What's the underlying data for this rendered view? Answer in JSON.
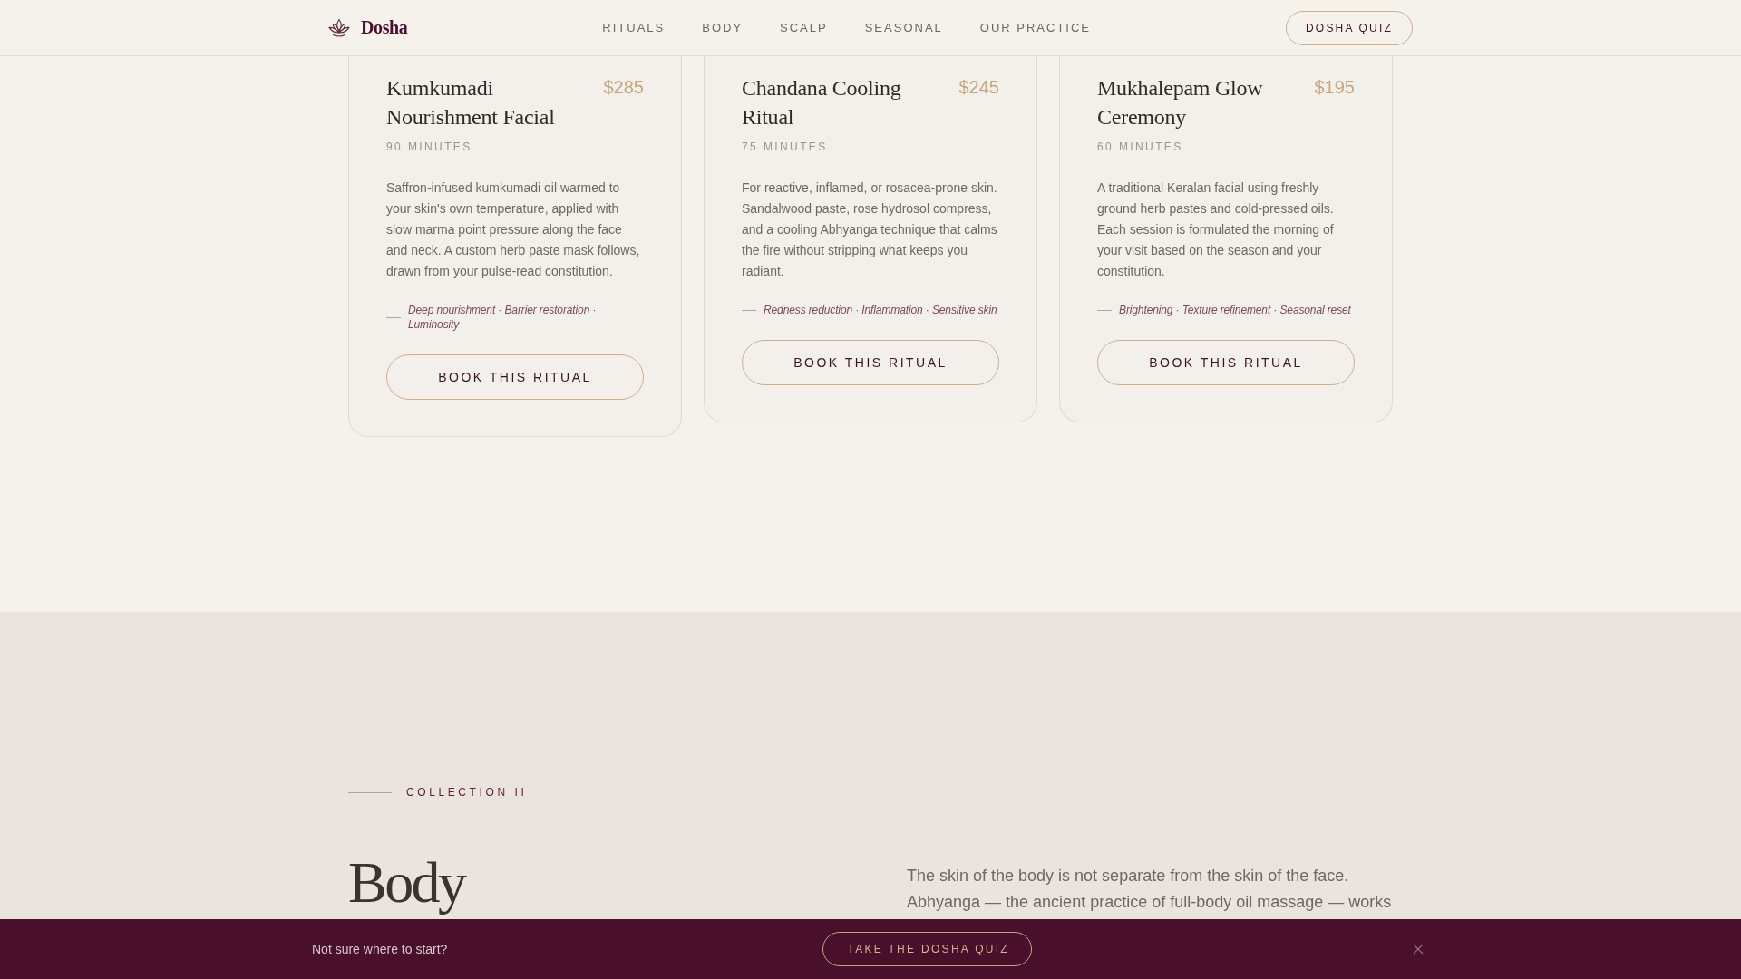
{
  "header": {
    "brand": "Dosha",
    "nav": [
      "RITUALS",
      "BODY",
      "SCALP",
      "SEASONAL",
      "OUR PRACTICE"
    ],
    "cta": "DOSHA QUIZ"
  },
  "rituals": [
    {
      "title": "Kumkumadi Nourishment Facial",
      "price": "$285",
      "duration": "90 MINUTES",
      "description": "Saffron-infused kumkumadi oil warmed to your skin's own temperature, applied with slow marma point pressure along the face and neck. A custom herb paste mask follows, drawn from your pulse-read constitution.",
      "benefits": "Deep nourishment · Barrier restoration · Luminosity",
      "button": "BOOK THIS RITUAL"
    },
    {
      "title": "Chandana Cooling Ritual",
      "price": "$245",
      "duration": "75 MINUTES",
      "description": "For reactive, inflamed, or rosacea-prone skin. Sandalwood paste, rose hydrosol compress, and a cooling Abhyanga technique that calms the fire without stripping what keeps you radiant.",
      "benefits": "Redness reduction · Inflammation · Sensitive skin",
      "button": "BOOK THIS RITUAL"
    },
    {
      "title": "Mukhalepam Glow Ceremony",
      "price": "$195",
      "duration": "60 MINUTES",
      "description": "A traditional Keralan facial using freshly ground herb pastes and cold-pressed oils. Each session is formulated the morning of your visit based on the season and your constitution.",
      "benefits": "Brightening · Texture refinement · Seasonal reset",
      "button": "BOOK THIS RITUAL"
    }
  ],
  "collection": {
    "eyebrow": "COLLECTION II",
    "title": "Body",
    "intro": "The skin of the body is not separate from the skin of the face. Abhyanga — the ancient practice of full-body oil massage — works"
  },
  "quiz_bar": {
    "prompt": "Not sure where to start?",
    "button": "TAKE THE DOSHA QUIZ"
  }
}
